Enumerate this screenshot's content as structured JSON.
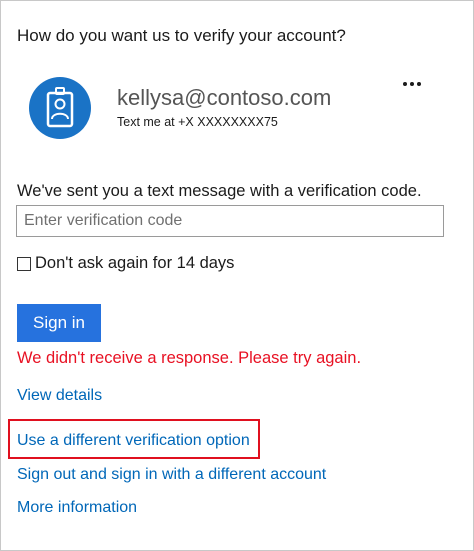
{
  "heading": "How do you want us to verify your account?",
  "account": {
    "email": "kellysa@contoso.com",
    "method": "Text me at +X XXXXXXXX75",
    "avatar_icon": "id-badge-icon",
    "avatar_color": "#1a73c6"
  },
  "more_options_icon": "more-options-icon",
  "verification": {
    "message": "We've sent you a text message with a verification code.",
    "input_placeholder": "Enter verification code",
    "input_value": "",
    "dont_ask_label": "Don't ask again for 14 days",
    "dont_ask_checked": false
  },
  "sign_in_label": "Sign in",
  "error_message": "We didn't receive a response. Please try again.",
  "links": {
    "view_details": "View details",
    "different_option": "Use a different verification option",
    "sign_out": "Sign out and sign in with a different account",
    "more_info": "More information"
  },
  "colors": {
    "accent": "#2672de",
    "link": "#0067b8",
    "error": "#e81123",
    "highlight": "#e0101f"
  }
}
